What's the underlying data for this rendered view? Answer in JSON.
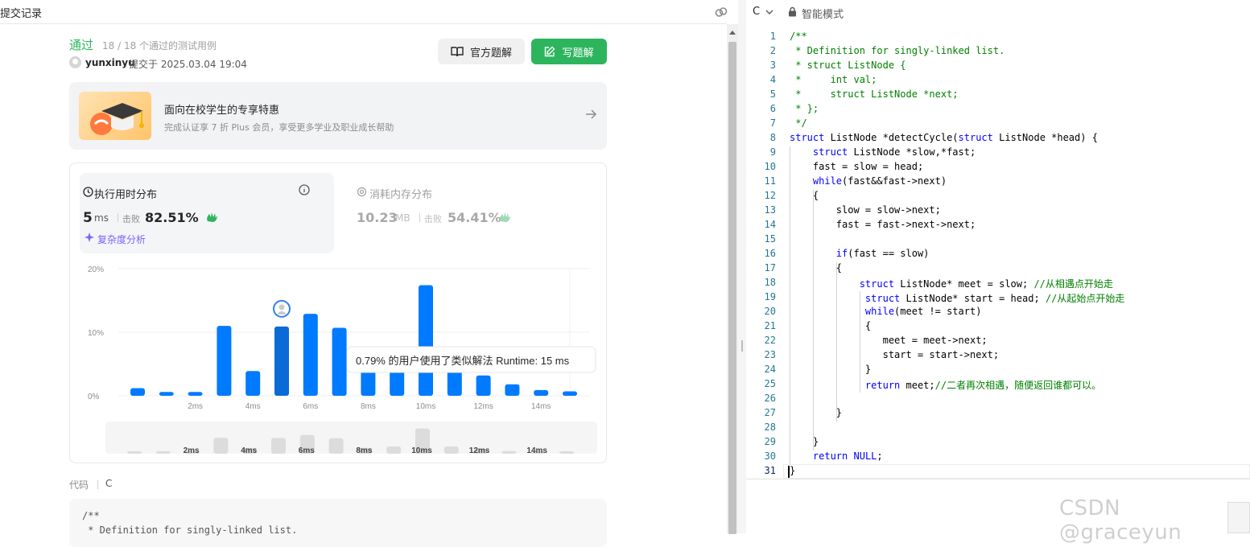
{
  "left_header": {
    "title": "提交记录"
  },
  "result": {
    "status": "通过",
    "cases": "18 / 18 个通过的测试用例",
    "user": "yunxinyu",
    "submitted": "提交于 2025.03.04 19:04",
    "btn_official": "官方题解",
    "btn_write": "写题解"
  },
  "promo": {
    "title": "面向在校学生的专享特惠",
    "subtitle": "完成认证享 7 折 Plus 会员，享受更多学业及职业成长帮助"
  },
  "runtime": {
    "title": "执行用时分布",
    "value": "5",
    "unit": "ms",
    "beat_label": "击败",
    "beat_pct": "82.51%",
    "complexity": "复杂度分析"
  },
  "memory": {
    "title": "消耗内存分布",
    "value": "10.23",
    "unit": "MB",
    "beat_label": "击败",
    "beat_pct": "54.41%"
  },
  "chart_data": {
    "type": "bar",
    "title": "",
    "xlabel": "",
    "ylabel": "",
    "ylim": [
      0,
      20
    ],
    "y_ticks": [
      "20%",
      "10%",
      "0%"
    ],
    "x_ticks": [
      "2ms",
      "4ms",
      "6ms",
      "8ms",
      "10ms",
      "12ms",
      "14ms"
    ],
    "overview_ticks": [
      "2ms",
      "4ms",
      "6ms",
      "8ms",
      "10ms",
      "12ms",
      "14ms"
    ],
    "values": [
      1.2,
      0.6,
      0.6,
      11.0,
      3.9,
      10.9,
      12.9,
      10.7,
      4.0,
      5.0,
      17.4,
      5.0,
      3.2,
      1.8,
      0.9,
      0.7
    ],
    "user_bar_index": 5,
    "tooltip": "0.79% 的用户使用了类似解法 Runtime: 15 ms",
    "colors": {
      "bar": "#007aff",
      "user_bar": "#0a6bd6",
      "grid": "#eeeeee"
    }
  },
  "code_section": {
    "label": "代码",
    "lang": "C"
  },
  "code_preview": [
    "/**",
    " * Definition for singly-linked list."
  ],
  "editor_header": {
    "lang": "C",
    "mode": "智能模式"
  },
  "editor_lines": [
    [
      [
        "cm",
        "/**"
      ]
    ],
    [
      [
        "cm",
        " * Definition for singly-linked list."
      ]
    ],
    [
      [
        "cm",
        " * struct ListNode {"
      ]
    ],
    [
      [
        "cm",
        " *     int val;"
      ]
    ],
    [
      [
        "cm",
        " *     struct ListNode *next;"
      ]
    ],
    [
      [
        "cm",
        " * };"
      ]
    ],
    [
      [
        "cm",
        " */"
      ]
    ],
    [
      [
        "ty",
        "struct"
      ],
      [
        "",
        " ListNode *detectCycle("
      ],
      [
        "ty",
        "struct"
      ],
      [
        "",
        " ListNode *head) {"
      ]
    ],
    [
      [
        "",
        "    "
      ],
      [
        "ty",
        "struct"
      ],
      [
        "",
        " ListNode *slow,*fast;"
      ]
    ],
    [
      [
        "",
        "    fast = slow = head;"
      ]
    ],
    [
      [
        "",
        "    "
      ],
      [
        "kw",
        "while"
      ],
      [
        "",
        "(fast&&fast->next)"
      ]
    ],
    [
      [
        "",
        "    {"
      ]
    ],
    [
      [
        "",
        "        slow = slow->next;"
      ]
    ],
    [
      [
        "",
        "        fast = fast->next->next;"
      ]
    ],
    [
      [
        "",
        ""
      ]
    ],
    [
      [
        "",
        "        "
      ],
      [
        "kw",
        "if"
      ],
      [
        "",
        "(fast == slow)"
      ]
    ],
    [
      [
        "",
        "        {"
      ]
    ],
    [
      [
        "",
        "            "
      ],
      [
        "ty",
        "struct"
      ],
      [
        "",
        " ListNode* meet = slow; "
      ],
      [
        "cm",
        "//从相遇点开始走"
      ]
    ],
    [
      [
        "",
        "             "
      ],
      [
        "ty",
        "struct"
      ],
      [
        "",
        " ListNode* start = head; "
      ],
      [
        "cm",
        "//从起始点开始走"
      ]
    ],
    [
      [
        "",
        "             "
      ],
      [
        "kw",
        "while"
      ],
      [
        "",
        "(meet != start)"
      ]
    ],
    [
      [
        "",
        "             {"
      ]
    ],
    [
      [
        "",
        "                meet = meet->next;"
      ]
    ],
    [
      [
        "",
        "                start = start->next;"
      ]
    ],
    [
      [
        "",
        "             }"
      ]
    ],
    [
      [
        "",
        "             "
      ],
      [
        "kw",
        "return"
      ],
      [
        "",
        " meet;"
      ],
      [
        "cm",
        "//二者再次相遇，随便返回谁都可以。"
      ]
    ],
    [
      [
        "",
        ""
      ]
    ],
    [
      [
        "",
        "        }"
      ]
    ],
    [
      [
        "",
        ""
      ]
    ],
    [
      [
        "",
        "    }"
      ]
    ],
    [
      [
        "",
        "    "
      ],
      [
        "kw",
        "return"
      ],
      [
        "",
        " "
      ],
      [
        "kw",
        "NULL"
      ],
      [
        "",
        ";"
      ]
    ],
    [
      [
        "",
        "}"
      ]
    ]
  ],
  "watermark": "CSDN @graceyun"
}
